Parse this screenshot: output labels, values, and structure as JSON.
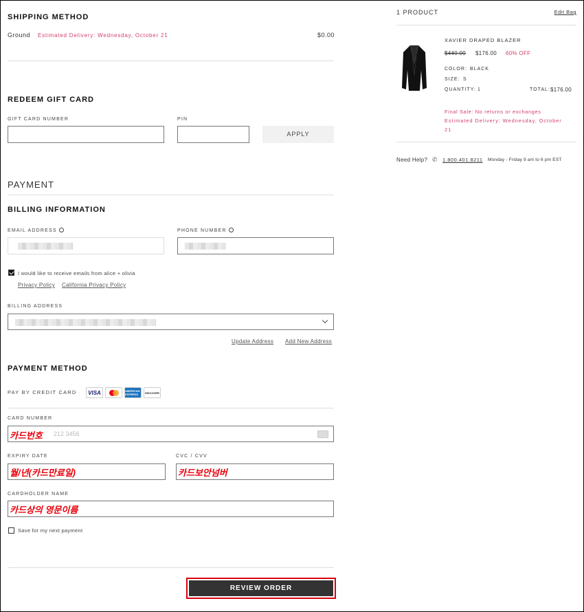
{
  "shipping": {
    "title": "SHIPPING METHOD",
    "method": "Ground",
    "estimated": "Estimated Delivery: Wednesday, October 21",
    "price": "$0.00"
  },
  "gift": {
    "title": "REDEEM GIFT CARD",
    "card_label": "GIFT CARD NUMBER",
    "pin_label": "PIN",
    "apply_label": "APPLY"
  },
  "payment": {
    "title": "PAYMENT"
  },
  "billing": {
    "title": "BILLING INFORMATION",
    "email_label": "EMAIL ADDRESS",
    "phone_label": "PHONE NUMBER",
    "optin_label": "I would like to receive emails from alice + olivia",
    "privacy_link": "Privacy Policy",
    "ca_privacy_link": "California Privacy Policy",
    "address_label": "BILLING ADDRESS",
    "update_link": "Update Address",
    "add_link": "Add New Address"
  },
  "method": {
    "title": "PAYMENT METHOD",
    "pay_label": "PAY BY CREDIT CARD",
    "cards": [
      "VISA",
      "AMERICAN EXPRESS",
      "DISCOVER"
    ],
    "card_number_label": "CARD NUMBER",
    "card_number_placeholder": "212 3456",
    "expiry_label": "EXPIRY DATE",
    "cvc_label": "CVC / CVV",
    "holder_label": "CARDHOLDER NAME",
    "save_label": "Save for my next payment",
    "review_label": "REVIEW ORDER"
  },
  "annotations": {
    "card_number": "카드번호",
    "expiry": "월/년(카드만료일)",
    "cvc": "카드보안넘버",
    "holder": "카드상의 영문이름"
  },
  "summary": {
    "count": "1 PRODUCT",
    "edit_bag": "Edit Bag",
    "product_name": "XAVIER DRAPED BLAZER",
    "original_price": "$440.00",
    "sale_price": "$176.00",
    "discount": "60% OFF",
    "color_label": "COLOR:",
    "color_value": "BLACK",
    "size_label": "SIZE:",
    "size_value": "S",
    "qty_label": "QUANTITY:",
    "qty_value": "1",
    "total_label": "TOTAL:",
    "total_value": "$176.00",
    "final_sale": "Final Sale: No returns or exchanges",
    "estimated_1": "Estimated Delivery: Wednesday, October",
    "estimated_2": "21",
    "help_label": "Need Help?",
    "phone": "1.800.401.8211",
    "hours": "Monday - Friday 9 am to 6 pm EST"
  }
}
